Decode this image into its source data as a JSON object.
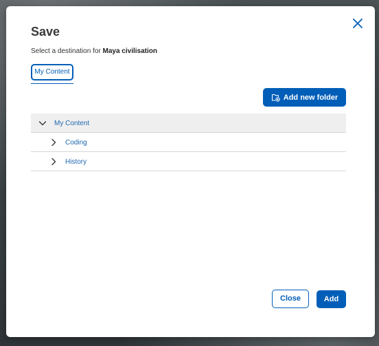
{
  "dialog": {
    "title": "Save",
    "subtitle_prefix": "Select a destination for ",
    "subtitle_item": "Maya civilisation"
  },
  "tabs": [
    {
      "label": "My Content",
      "selected": true
    }
  ],
  "toolbar": {
    "add_folder_label": "Add new folder",
    "add_folder_icon": "folder-plus-icon"
  },
  "tree": {
    "root": {
      "label": "My Content",
      "expanded": true
    },
    "children": [
      {
        "label": "Coding",
        "expanded": false
      },
      {
        "label": "History",
        "expanded": false
      }
    ]
  },
  "footer": {
    "close_label": "Close",
    "add_label": "Add"
  },
  "colors": {
    "accent": "#005eb8",
    "tree_root_bg": "#efefef",
    "link_text": "#1e67b0"
  }
}
